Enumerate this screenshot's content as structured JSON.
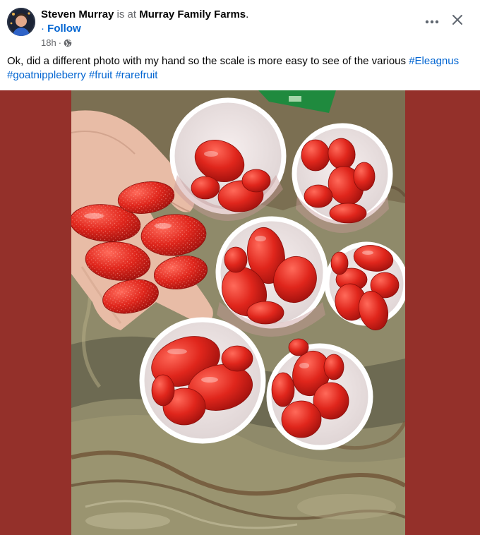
{
  "post": {
    "author_name": "Steven Murray",
    "connector": "is at",
    "place": "Murray Family Farms",
    "period": ".",
    "follow_dot": "·",
    "follow_label": "Follow",
    "timestamp": "18h",
    "privacy_dot": "·",
    "caption_text": "Ok, did a different photo with my hand so the scale is more easy to see of the various ",
    "hashtags": [
      "#Eleagnus",
      "#goatnippleberry",
      "#fruit",
      "#rarefruit"
    ],
    "header_icons": [
      "more-options-icon",
      "close-icon",
      "globe-icon"
    ]
  },
  "colors": {
    "link_blue": "#0064d1",
    "secondary_text": "#65676b",
    "media_background": "#94302a"
  }
}
